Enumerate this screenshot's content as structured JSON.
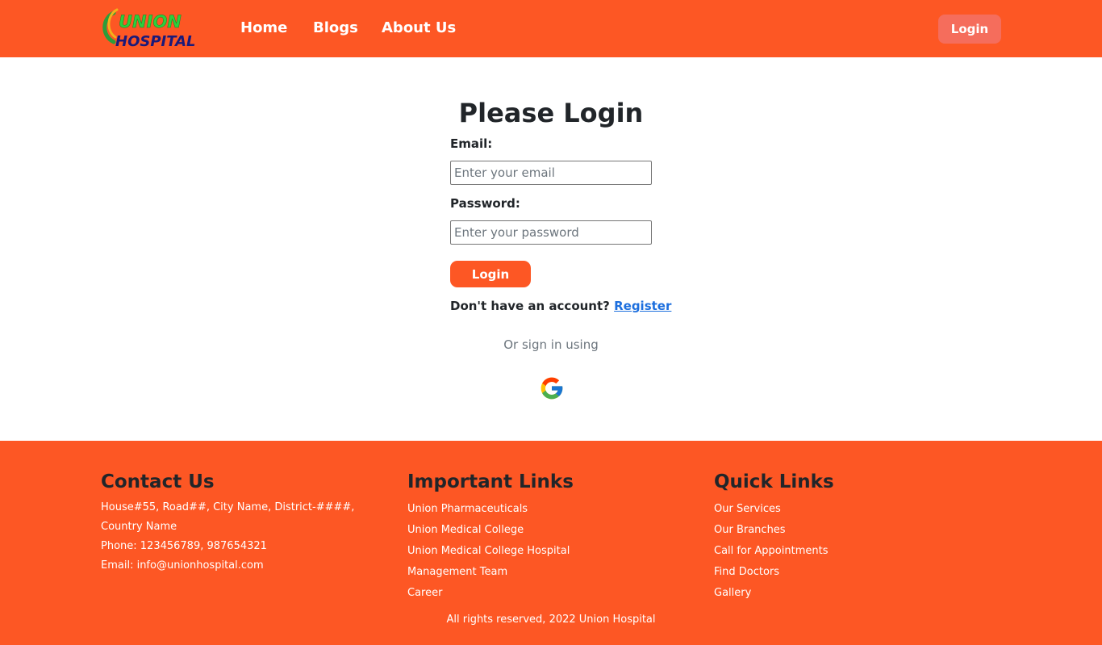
{
  "brand": {
    "logo_line1": "UNION",
    "logo_line2": "HOSPITAL"
  },
  "nav": {
    "home": "Home",
    "blogs": "Blogs",
    "about": "About Us",
    "login_button": "Login"
  },
  "login": {
    "title": "Please Login",
    "email_label": "Email:",
    "email_placeholder": "Enter your email",
    "password_label": "Password:",
    "password_placeholder": "Enter your password",
    "submit_label": "Login",
    "no_account_text": "Don't have an account?",
    "register_link": "Register",
    "or_signin_text": "Or sign in using",
    "google_icon": "google-icon"
  },
  "footer": {
    "contact": {
      "heading": "Contact Us",
      "address": "House#55, Road##, City Name, District-####, Country Name",
      "phone": "Phone: 123456789, 987654321",
      "email": "Email: info@unionhospital.com"
    },
    "important_links": {
      "heading": "Important Links",
      "items": [
        "Union Pharmaceuticals",
        "Union Medical College",
        "Union Medical College Hospital",
        "Management Team",
        "Career"
      ]
    },
    "quick_links": {
      "heading": "Quick Links",
      "items": [
        "Our Services",
        "Our Branches",
        "Call for Appointments",
        "Find Doctors",
        "Gallery"
      ]
    },
    "copyright": "All rights reserved, 2022 Union Hospital"
  },
  "colors": {
    "brand_orange": "#fd5724",
    "header_login_bg": "#f56d5c",
    "link_blue": "#1d6fde"
  }
}
